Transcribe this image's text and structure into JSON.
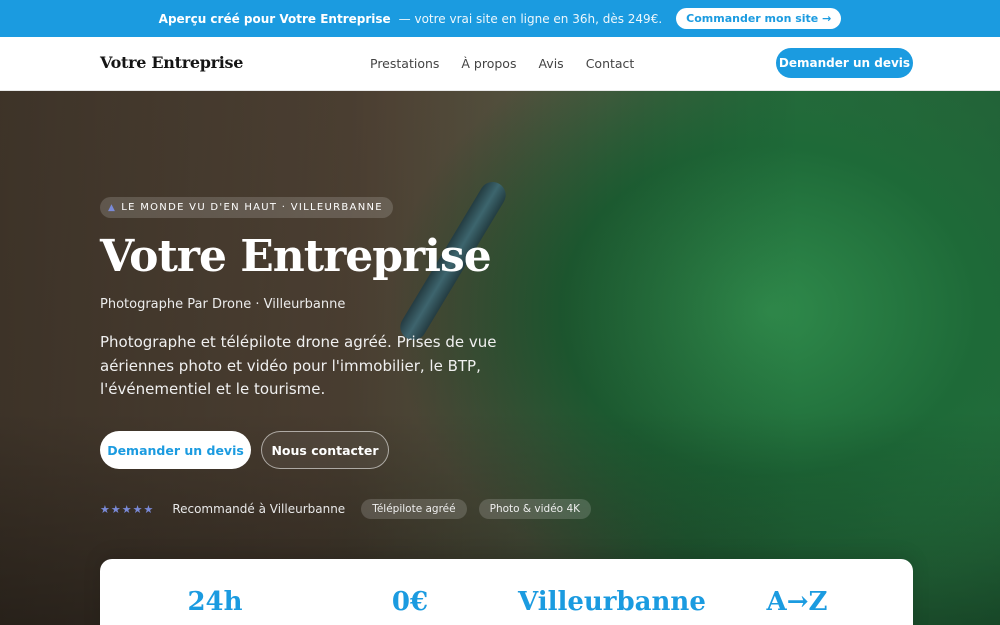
{
  "promo": {
    "strong": "Aperçu créé pour Votre Entreprise",
    "rest": "— votre vrai site en ligne en 36h, dès 249€.",
    "cta": "Commander mon site →"
  },
  "header": {
    "brand": "Votre Entreprise",
    "nav": [
      "Prestations",
      "À propos",
      "Avis",
      "Contact"
    ],
    "cta": "Demander un devis"
  },
  "hero": {
    "tag": "LE MONDE VU D'EN HAUT · VILLEURBANNE",
    "tag_icon": "triangle-icon",
    "title": "Votre Entreprise",
    "subtitle": "Photographe Par Drone · Villeurbanne",
    "description": "Photographe et télépilote drone agréé. Prises de vue aériennes photo et vidéo pour l'immobilier, le BTP, l'événementiel et le tourisme.",
    "primary_button": "Demander un devis",
    "secondary_button": "Nous contacter",
    "stars": "★★★★★",
    "rating": 5,
    "recommended": "Recommandé à Villeurbanne",
    "chips": [
      "Télépilote agréé",
      "Photo & vidéo 4K"
    ]
  },
  "stats": [
    "24h",
    "0€",
    "Villeurbanne",
    "A→Z"
  ],
  "colors": {
    "accent": "#1b9be0",
    "star": "#7a8ad8",
    "heading": "#ffffff"
  }
}
